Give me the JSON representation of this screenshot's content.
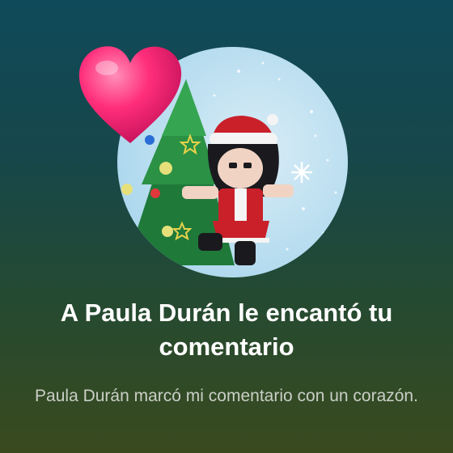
{
  "notification": {
    "title": "A Paula Durán le encantó tu comentario",
    "message": "Paula Durán marcó mi comentario con un corazón.",
    "avatar_icon": "user-avatar-christmas",
    "reaction_icon": "heart-icon",
    "colors": {
      "heart": "#ff2e7a",
      "title_text": "#ffffff",
      "message_text": "#c9cfc6",
      "avatar_bg": "#b9def0"
    }
  }
}
